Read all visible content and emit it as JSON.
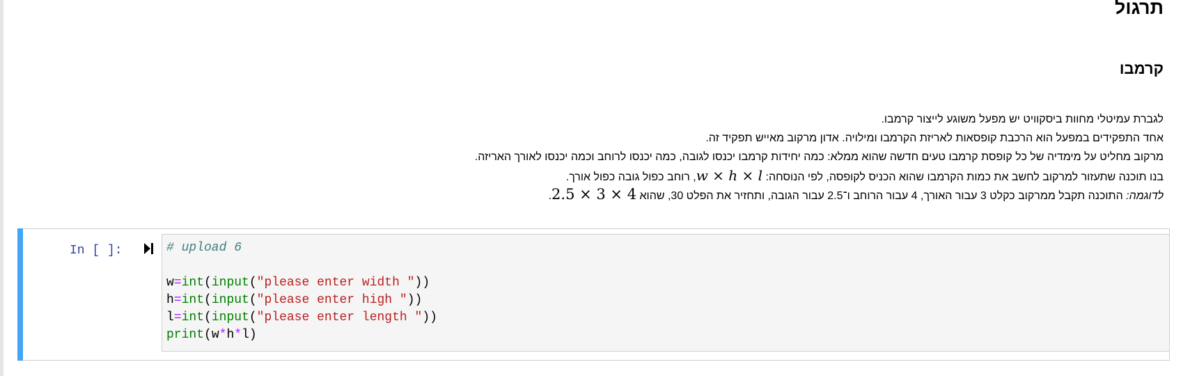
{
  "markdown": {
    "title": "תרגול",
    "subtitle": "קרמבו",
    "line1": "לגברת עמיטלי מחוות ביסקוויט יש מפעל משוגע לייצור קרמבו.",
    "line2": "אחד התפקידים במפעל הוא הרכבת קופסאות לאריזת הקרמבו ומילויה. אדון מרקוב מאייש תפקיד זה.",
    "line3": "מרקוב מחליט על מימדיה של כל קופסת קרמבו טעים חדשה שהוא ממלא: כמה יחידות קרמבו יכנסו לגובה, כמה יכנסו לרוחב וכמה יכנסו לאורך האריזה.",
    "line4_a": "בנו תוכנה שתעזור למרקוב לחשב את כמות הקרמבו שהוא הכניס לקופסה, לפי הנוסחה: ",
    "line4_formula": "w × h × l",
    "line4_b": ", רוחב כפול גובה כפול אורך.",
    "line5_em": "לדוגמה:",
    "line5_a": " התוכנה תקבל ממרקוב כקלט 3 עבור האורך, 4 עבור הרוחב ו־2.5 עבור הגובה, ותחזיר את הפלט 30, שהוא ",
    "line5_formula": "2.5 × 3 × 4",
    "line5_b": "."
  },
  "cell": {
    "prompt": "In [ ]:",
    "run_icon": "step-run-icon",
    "accent_color": "#42a5f5",
    "code": {
      "comment": "# upload 6",
      "l1_var": "w",
      "l1_eq": "=",
      "l1_int": "int",
      "l1_p1": "(",
      "l1_input": "input",
      "l1_p2": "(",
      "l1_str": "\"please enter width \"",
      "l1_p3": "))",
      "l2_var": "h",
      "l2_eq": "=",
      "l2_int": "int",
      "l2_p1": "(",
      "l2_input": "input",
      "l2_p2": "(",
      "l2_str": "\"please enter high \"",
      "l2_p3": "))",
      "l3_var": "l",
      "l3_eq": "=",
      "l3_int": "int",
      "l3_p1": "(",
      "l3_input": "input",
      "l3_p2": "(",
      "l3_str": "\"please enter length \"",
      "l3_p3": "))",
      "l4_print": "print",
      "l4_p1": "(",
      "l4_w": "w",
      "l4_op1": "*",
      "l4_h": "h",
      "l4_op2": "*",
      "l4_l": "l",
      "l4_p2": ")"
    }
  }
}
